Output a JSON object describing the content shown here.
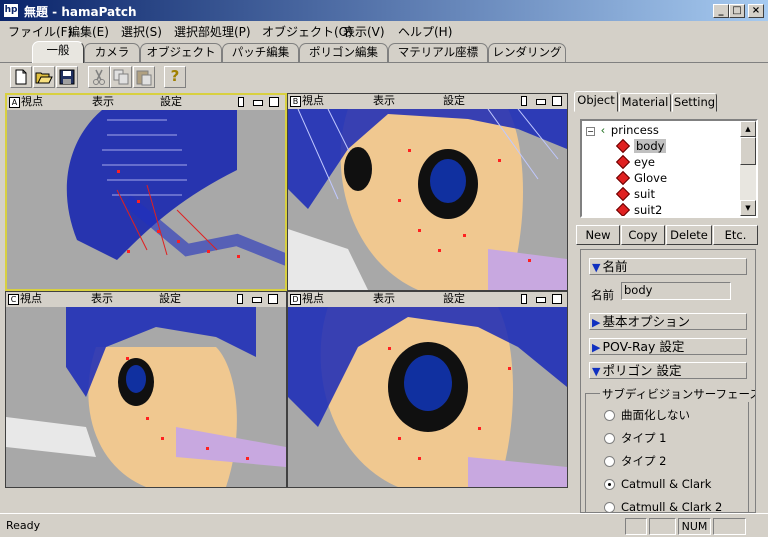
{
  "window": {
    "icon_text": "hp",
    "title": "無題 - hamaPatch",
    "buttons": [
      "_",
      "□",
      "×"
    ]
  },
  "menu": [
    "ファイル(F)",
    "編集(E)",
    "選択(S)",
    "選択部処理(P)",
    "オブジェクト(O)",
    "表示(V)",
    "ヘルプ(H)"
  ],
  "tabs": [
    "一般",
    "カメラ",
    "オブジェクト",
    "パッチ編集",
    "ポリゴン編集",
    "マテリアル座標",
    "レンダリング"
  ],
  "active_tab": "一般",
  "toolbar": {
    "icons": [
      "new-file-icon",
      "open-folder-icon",
      "save-icon",
      "cut-icon",
      "copy-icon",
      "paste-icon",
      "help-icon"
    ],
    "help_glyph": "?"
  },
  "viewports": [
    {
      "letter": "A",
      "viewpoint": "視点",
      "display": "表示",
      "settings": "設定"
    },
    {
      "letter": "B",
      "viewpoint": "視点",
      "display": "表示",
      "settings": "設定"
    },
    {
      "letter": "C",
      "viewpoint": "視点",
      "display": "表示",
      "settings": "設定"
    },
    {
      "letter": "D",
      "viewpoint": "視点",
      "display": "表示",
      "settings": "設定"
    }
  ],
  "panel": {
    "tabs": [
      "Object",
      "Material",
      "Setting"
    ],
    "tree": {
      "root": "princess",
      "items": [
        "body",
        "eye",
        "Glove",
        "suit",
        "suit2"
      ],
      "selected": "body"
    },
    "buttons": [
      "New",
      "Copy",
      "Delete",
      "Etc."
    ],
    "name_section": "名前",
    "name_label": "名前",
    "name_value": "body",
    "basic_options": "基本オプション",
    "povray": "POV-Ray 設定",
    "polygon": "ポリゴン 設定",
    "subdivision": {
      "title": "サブディビジョンサーフェース",
      "options": [
        "曲面化しない",
        "タイプ 1",
        "タイプ 2",
        "Catmull & Clark",
        "Catmull & Clark 2"
      ],
      "selected": "Catmull & Clark"
    }
  },
  "status": {
    "text": "Ready",
    "num": "NUM"
  }
}
